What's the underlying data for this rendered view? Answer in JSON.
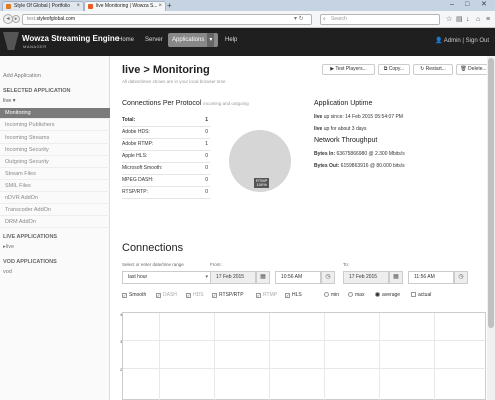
{
  "browser": {
    "tabs": [
      {
        "title": "Style Of Global | Portfolio"
      },
      {
        "title": "live Monitoring | Wowza S..."
      }
    ],
    "new_tab": "+",
    "url_prefix": "test.",
    "url_domain": "styleofglobal.com",
    "search_placeholder": "Search"
  },
  "header": {
    "brand_title": "Wowza Streaming Engine",
    "brand_sub": "MANAGER",
    "menu": {
      "home": "Home",
      "server": "Server",
      "applications": "Applications",
      "help": "Help"
    },
    "user": "Admin | Sign Out"
  },
  "sidebar": {
    "add_app": "Add Application",
    "selected_heading": "SELECTED APPLICATION",
    "selected_app": "live ▾",
    "items": [
      "Monitoring",
      "Incoming Publishers",
      "Incoming Streams",
      "Incoming Security",
      "Outgoing Security",
      "Stream Files",
      "SMIL Files",
      "nDVR AddOn",
      "Transcoder AddOn",
      "DRM AddOn"
    ],
    "live_heading": "LIVE APPLICATIONS",
    "live_apps": [
      "▸live"
    ],
    "vod_heading": "VOD APPLICATIONS",
    "vod_apps": [
      "vod"
    ]
  },
  "main": {
    "title": "live > Monitoring",
    "subtitle": "All dates/times shown are in your local browser time",
    "buttons": {
      "test_players": "▶ Test Players...",
      "copy": "⧉ Copy...",
      "restart": "↻ Restart...",
      "delete": "🗑 Delete..."
    },
    "protocol_heading": "Connections Per Protocol",
    "protocol_sub": "incoming and outgoing",
    "protocols": [
      {
        "name": "Total:",
        "value": "1"
      },
      {
        "name": "Adobe HDS:",
        "value": "0"
      },
      {
        "name": "Adobe RTMP:",
        "value": "1"
      },
      {
        "name": "Apple HLS:",
        "value": "0"
      },
      {
        "name": "Microsoft Smooth:",
        "value": "0"
      },
      {
        "name": "MPEG DASH:",
        "value": "0"
      },
      {
        "name": "RTSP/RTP:",
        "value": "0"
      }
    ],
    "pie_label_1": "RTMP",
    "pie_label_2": "100%",
    "uptime_heading": "Application Uptime",
    "uptime_line1_bold": "live",
    "uptime_line1": " up since: 14 Feb 2015 05:54:07 PM",
    "uptime_line2_bold": "live",
    "uptime_line2": " up for about 3 days",
    "throughput_heading": "Network Throughput",
    "bytes_in_label": "Bytes In:",
    "bytes_in_value": " 63675866980 @ 2.300 Mbits/s",
    "bytes_out_label": "Bytes Out:",
    "bytes_out_value": " 6159863916 @ 80.000 bits/s"
  },
  "connections": {
    "title": "Connections",
    "range_label": "Select or enter date/time range",
    "range_value": "last hour",
    "from_label": "From:",
    "from_date": "17 Feb 2015",
    "from_time": "10:56 AM",
    "to_label": "To:",
    "to_date": "17 Feb 2015",
    "to_time": "11:56 AM",
    "checks": [
      {
        "label": "Smooth",
        "checked": true
      },
      {
        "label": "DASH",
        "checked": true
      },
      {
        "label": "HDS",
        "checked": true
      },
      {
        "label": "RTSP/RTP",
        "checked": true
      },
      {
        "label": "RTMP",
        "checked": true
      },
      {
        "label": "HLS",
        "checked": true
      }
    ],
    "radios": [
      {
        "label": "min",
        "selected": false
      },
      {
        "label": "max",
        "selected": false
      },
      {
        "label": "average",
        "selected": true
      }
    ],
    "actual_label": "actual",
    "y_ticks": [
      "4",
      "3",
      "2"
    ]
  }
}
